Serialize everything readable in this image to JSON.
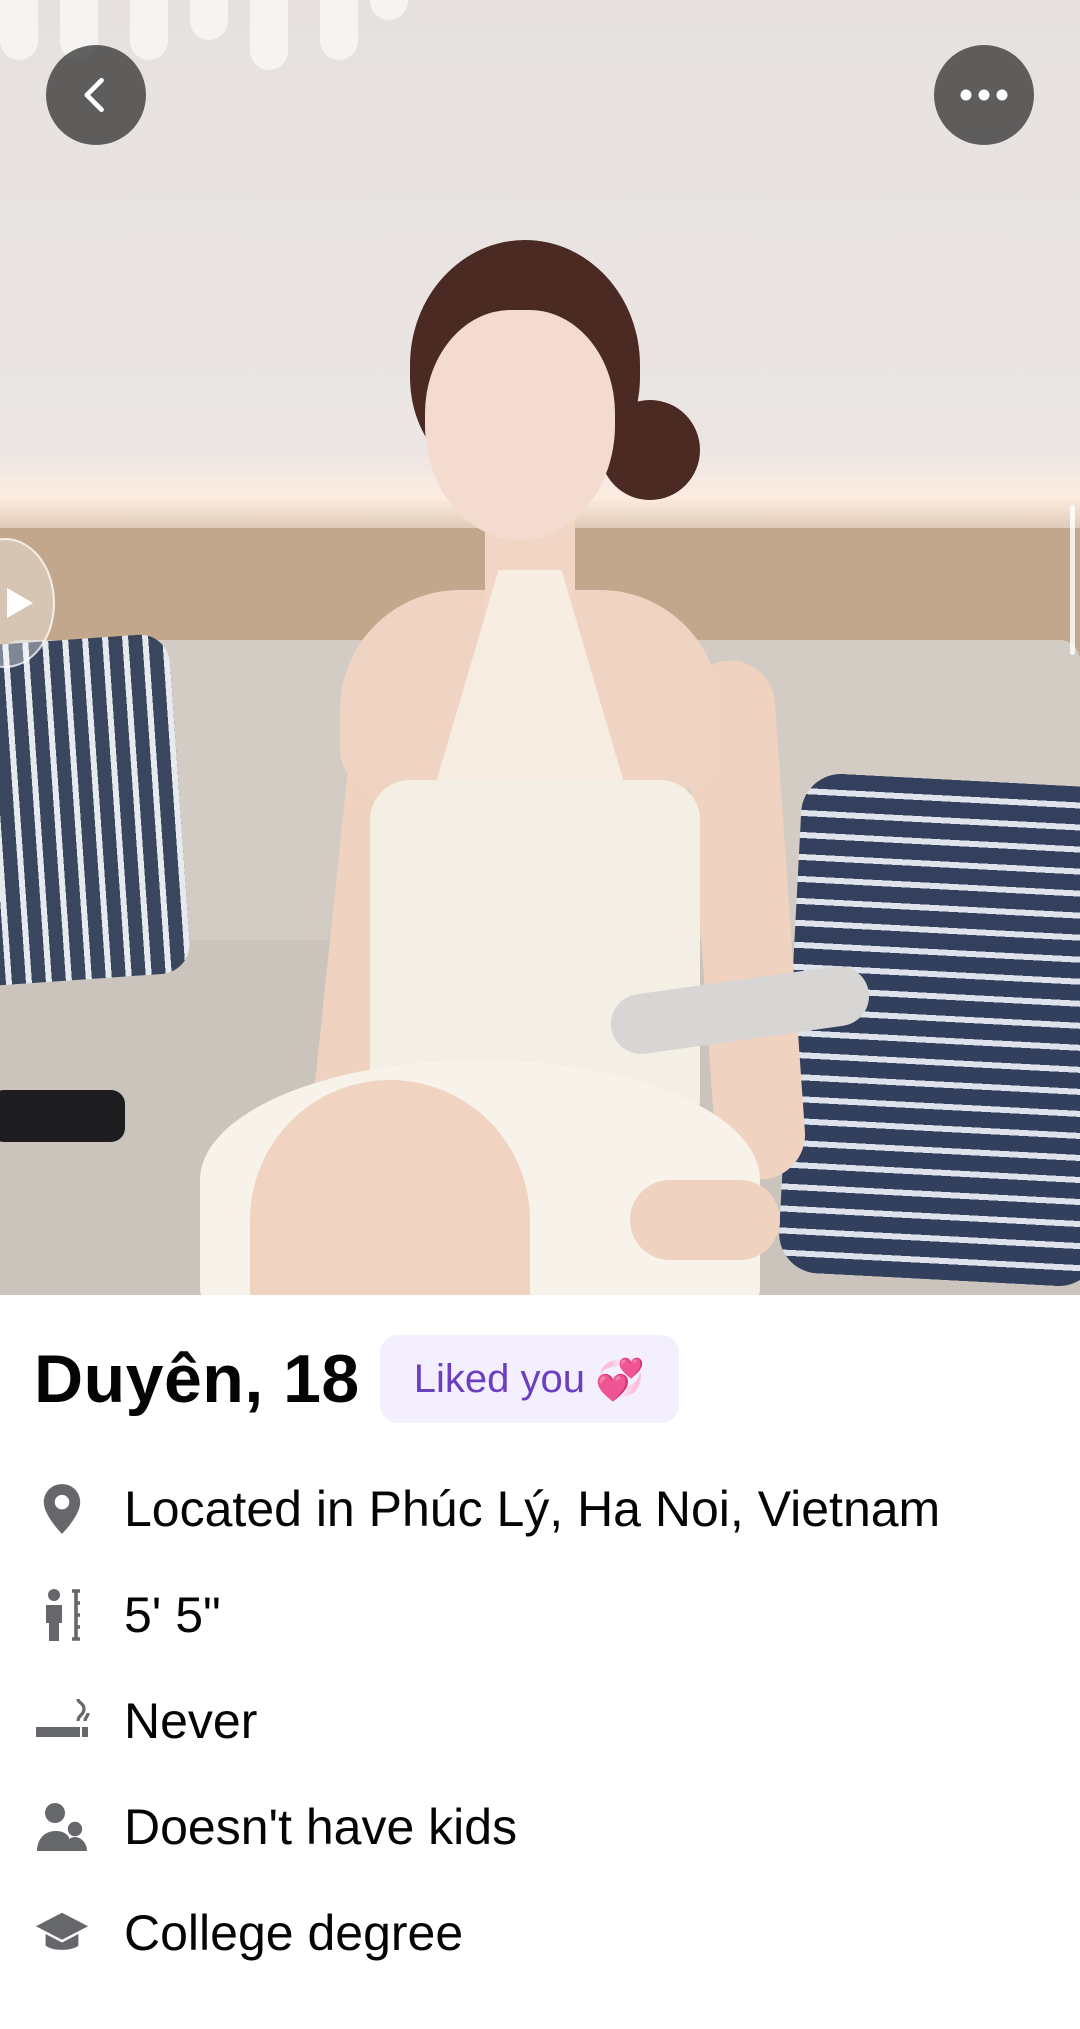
{
  "header": {
    "back_icon": "chevron-left-icon",
    "more_icon": "more-horizontal-icon"
  },
  "photo": {
    "video_icon": "play-icon"
  },
  "profile": {
    "name_age": "Duyên, 18",
    "liked_badge": {
      "label": "Liked you",
      "emoji": "💞",
      "text_color": "#6c3fc1",
      "background_color": "#f3efff"
    },
    "details": [
      {
        "icon": "location-pin-icon",
        "text": "Located in Phúc Lý, Ha Noi, Vietnam"
      },
      {
        "icon": "height-icon",
        "text": "5' 5\""
      },
      {
        "icon": "smoking-icon",
        "text": "Never"
      },
      {
        "icon": "children-icon",
        "text": "Doesn't have kids"
      },
      {
        "icon": "education-cap-icon",
        "text": "College degree"
      }
    ]
  }
}
